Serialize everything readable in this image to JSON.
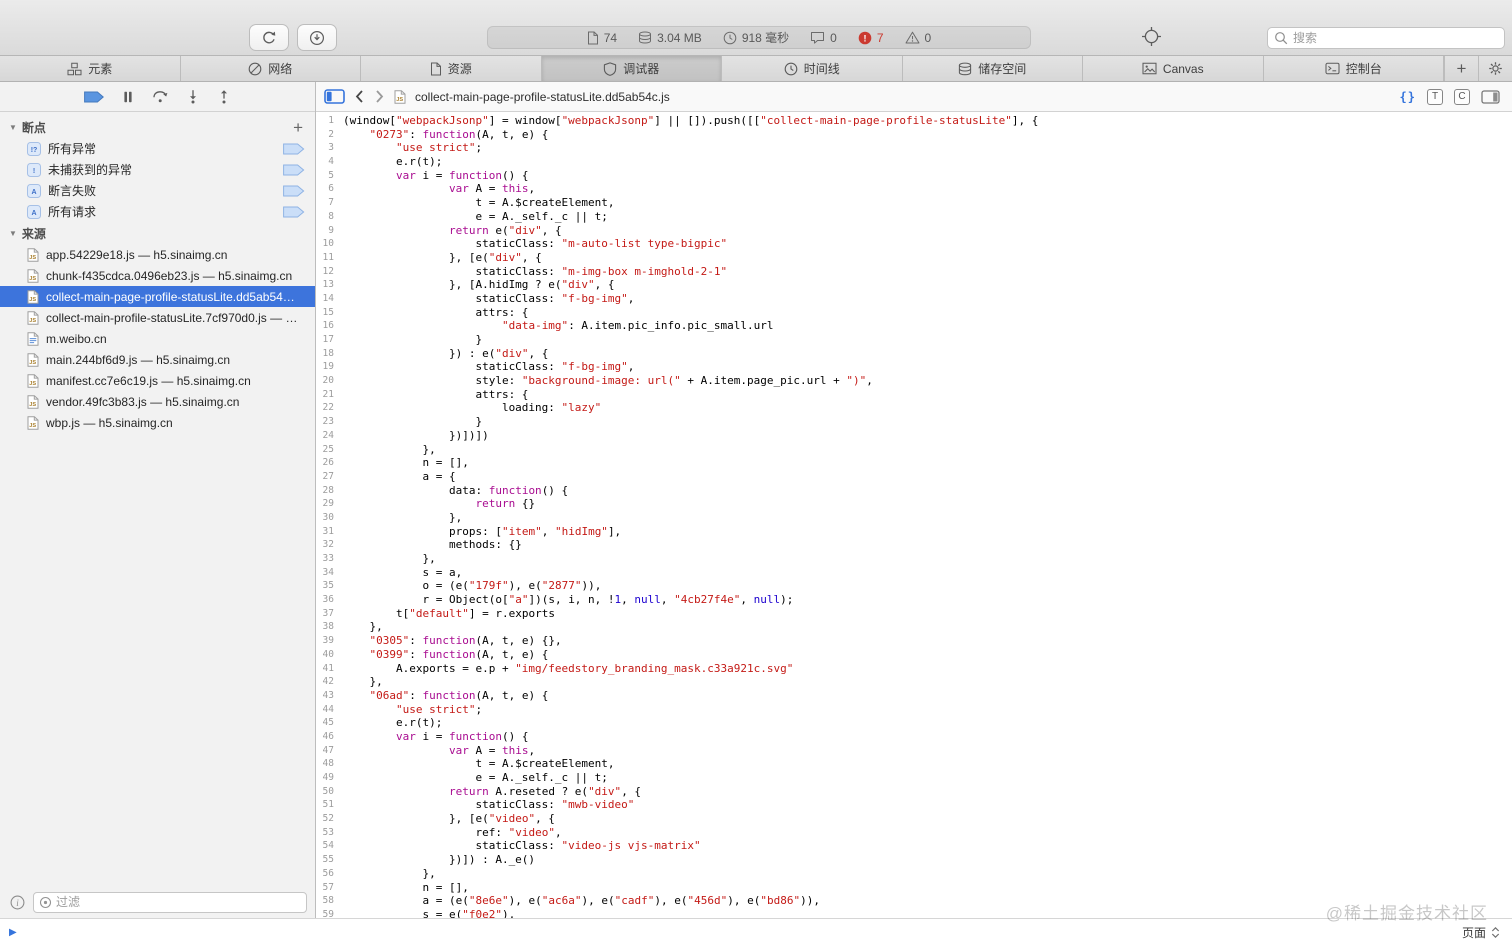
{
  "toolbar": {
    "stats": {
      "resource_count": "74",
      "transfer_size": "3.04 MB",
      "load_time": "918 毫秒",
      "console_logs": "0",
      "console_errors": "7",
      "console_warnings": "0"
    },
    "search_placeholder": "搜索"
  },
  "icons": {
    "reload": "circular-arrow",
    "download": "circle-down-arrow",
    "resource_count": "document",
    "transfer_size": "database",
    "load_time": "clock",
    "console_logs": "speech-bubble",
    "console_errors": "red-exclamation-circle",
    "console_warnings": "warning-triangle",
    "element_picker": "crosshair",
    "search": "magnifier",
    "new_tab": "plus",
    "settings": "gear"
  },
  "tabs": [
    {
      "id": "elements",
      "label": "元素"
    },
    {
      "id": "network",
      "label": "网络"
    },
    {
      "id": "resources",
      "label": "资源"
    },
    {
      "id": "debugger",
      "label": "调试器",
      "active": true
    },
    {
      "id": "timelines",
      "label": "时间线"
    },
    {
      "id": "storage",
      "label": "储存空间"
    },
    {
      "id": "canvas",
      "label": "Canvas"
    },
    {
      "id": "console",
      "label": "控制台"
    }
  ],
  "sidebar": {
    "breakpoints": {
      "title": "断点",
      "items": [
        {
          "label": "所有异常",
          "icon": "exceptions"
        },
        {
          "label": "未捕获到的异常",
          "icon": "uncaught"
        },
        {
          "label": "断言失败",
          "icon": "assert"
        },
        {
          "label": "所有请求",
          "icon": "requests"
        }
      ]
    },
    "sources": {
      "title": "来源",
      "items": [
        {
          "label": "app.54229e18.js — h5.sinaimg.cn",
          "type": "js"
        },
        {
          "label": "chunk-f435cdca.0496eb23.js — h5.sinaimg.cn",
          "type": "js"
        },
        {
          "label": "collect-main-page-profile-statusLite.dd5ab54…",
          "type": "js",
          "selected": true
        },
        {
          "label": "collect-main-profile-statusLite.7cf970d0.js — …",
          "type": "js"
        },
        {
          "label": "m.weibo.cn",
          "type": "page"
        },
        {
          "label": "main.244bf6d9.js — h5.sinaimg.cn",
          "type": "js"
        },
        {
          "label": "manifest.cc7e6c19.js — h5.sinaimg.cn",
          "type": "js"
        },
        {
          "label": "vendor.49fc3b83.js — h5.sinaimg.cn",
          "type": "js"
        },
        {
          "label": "wbp.js — h5.sinaimg.cn",
          "type": "js"
        }
      ]
    },
    "filter_placeholder": "过滤"
  },
  "content": {
    "file_name": "collect-main-page-profile-statusLite.dd5ab54c.js",
    "pretty_print_label": "{}",
    "type_profiler_label": "T",
    "code_coverage_label": "C",
    "code_lines": [
      "(window[\"webpackJsonp\"] = window[\"webpackJsonp\"] || []).push([[\"collect-main-page-profile-statusLite\"], {",
      "    \"0273\": function(A, t, e) {",
      "        \"use strict\";",
      "        e.r(t);",
      "        var i = function() {",
      "                var A = this,",
      "                    t = A.$createElement,",
      "                    e = A._self._c || t;",
      "                return e(\"div\", {",
      "                    staticClass: \"m-auto-list type-bigpic\"",
      "                }, [e(\"div\", {",
      "                    staticClass: \"m-img-box m-imghold-2-1\"",
      "                }, [A.hidImg ? e(\"div\", {",
      "                    staticClass: \"f-bg-img\",",
      "                    attrs: {",
      "                        \"data-img\": A.item.pic_info.pic_small.url",
      "                    }",
      "                }) : e(\"div\", {",
      "                    staticClass: \"f-bg-img\",",
      "                    style: \"background-image: url(\" + A.item.page_pic.url + \")\",",
      "                    attrs: {",
      "                        loading: \"lazy\"",
      "                    }",
      "                })])])",
      "            },",
      "            n = [],",
      "            a = {",
      "                data: function() {",
      "                    return {}",
      "                },",
      "                props: [\"item\", \"hidImg\"],",
      "                methods: {}",
      "            },",
      "            s = a,",
      "            o = (e(\"179f\"), e(\"2877\")),",
      "            r = Object(o[\"a\"])(s, i, n, !1, null, \"4cb27f4e\", null);",
      "        t[\"default\"] = r.exports",
      "    },",
      "    \"0305\": function(A, t, e) {},",
      "    \"0399\": function(A, t, e) {",
      "        A.exports = e.p + \"img/feedstory_branding_mask.c33a921c.svg\"",
      "    },",
      "    \"06ad\": function(A, t, e) {",
      "        \"use strict\";",
      "        e.r(t);",
      "        var i = function() {",
      "                var A = this,",
      "                    t = A.$createElement,",
      "                    e = A._self._c || t;",
      "                return A.reseted ? e(\"div\", {",
      "                    staticClass: \"mwb-video\"",
      "                }, [e(\"video\", {",
      "                    ref: \"video\",",
      "                    staticClass: \"video-js vjs-matrix\"",
      "                })]) : A._e()",
      "            },",
      "            n = [],",
      "            a = (e(\"8e6e\"), e(\"ac6a\"), e(\"cadf\"), e(\"456d\"), e(\"bd86\")),",
      "            s = e(\"f0e2\"),"
    ]
  },
  "statusbar": {
    "quick_console_label": "页面"
  },
  "watermark": "@稀土掘金技术社区",
  "colors": {
    "accent_blue": "#3574dc",
    "selection_blue": "#3d74dc",
    "error_red": "#cb3a30",
    "string_red": "#c41a16",
    "keyword_magenta": "#a90d91",
    "number_blue": "#1c00cf",
    "breakpoint_blue": "#5a95e0"
  }
}
